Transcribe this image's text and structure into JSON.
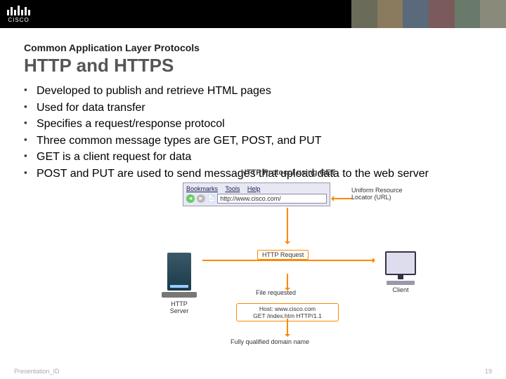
{
  "header": {
    "logo_text": "CISCO"
  },
  "slide": {
    "pretitle": "Common Application Layer Protocols",
    "title": "HTTP and HTTPS",
    "bullets": [
      "Developed to publish and retrieve HTML pages",
      "Used for data transfer",
      "Specifies a request/response protocol",
      "Three common message types are GET, POST, and PUT",
      "GET is a client request for data",
      "POST and PUT are used to send messages that upload data to the web server"
    ]
  },
  "diagram": {
    "title": "HTTP Protocol using GET",
    "browser_menu": [
      "Bookmarks",
      "Tools",
      "Help"
    ],
    "url": "http://www.cisco.com/",
    "uri_label": "Uniform Resource Locator (URL)",
    "request_label": "HTTP Request",
    "file_requested": "File requested",
    "host_line1": "Host: www.cisco.com",
    "host_line2": "GET /index.htm HTTP/1.1",
    "fqdn": "Fully qualified domain name",
    "server_label": "HTTP Server",
    "client_label": "Client"
  },
  "footer": {
    "left": "Presentation_ID",
    "right": "19"
  }
}
